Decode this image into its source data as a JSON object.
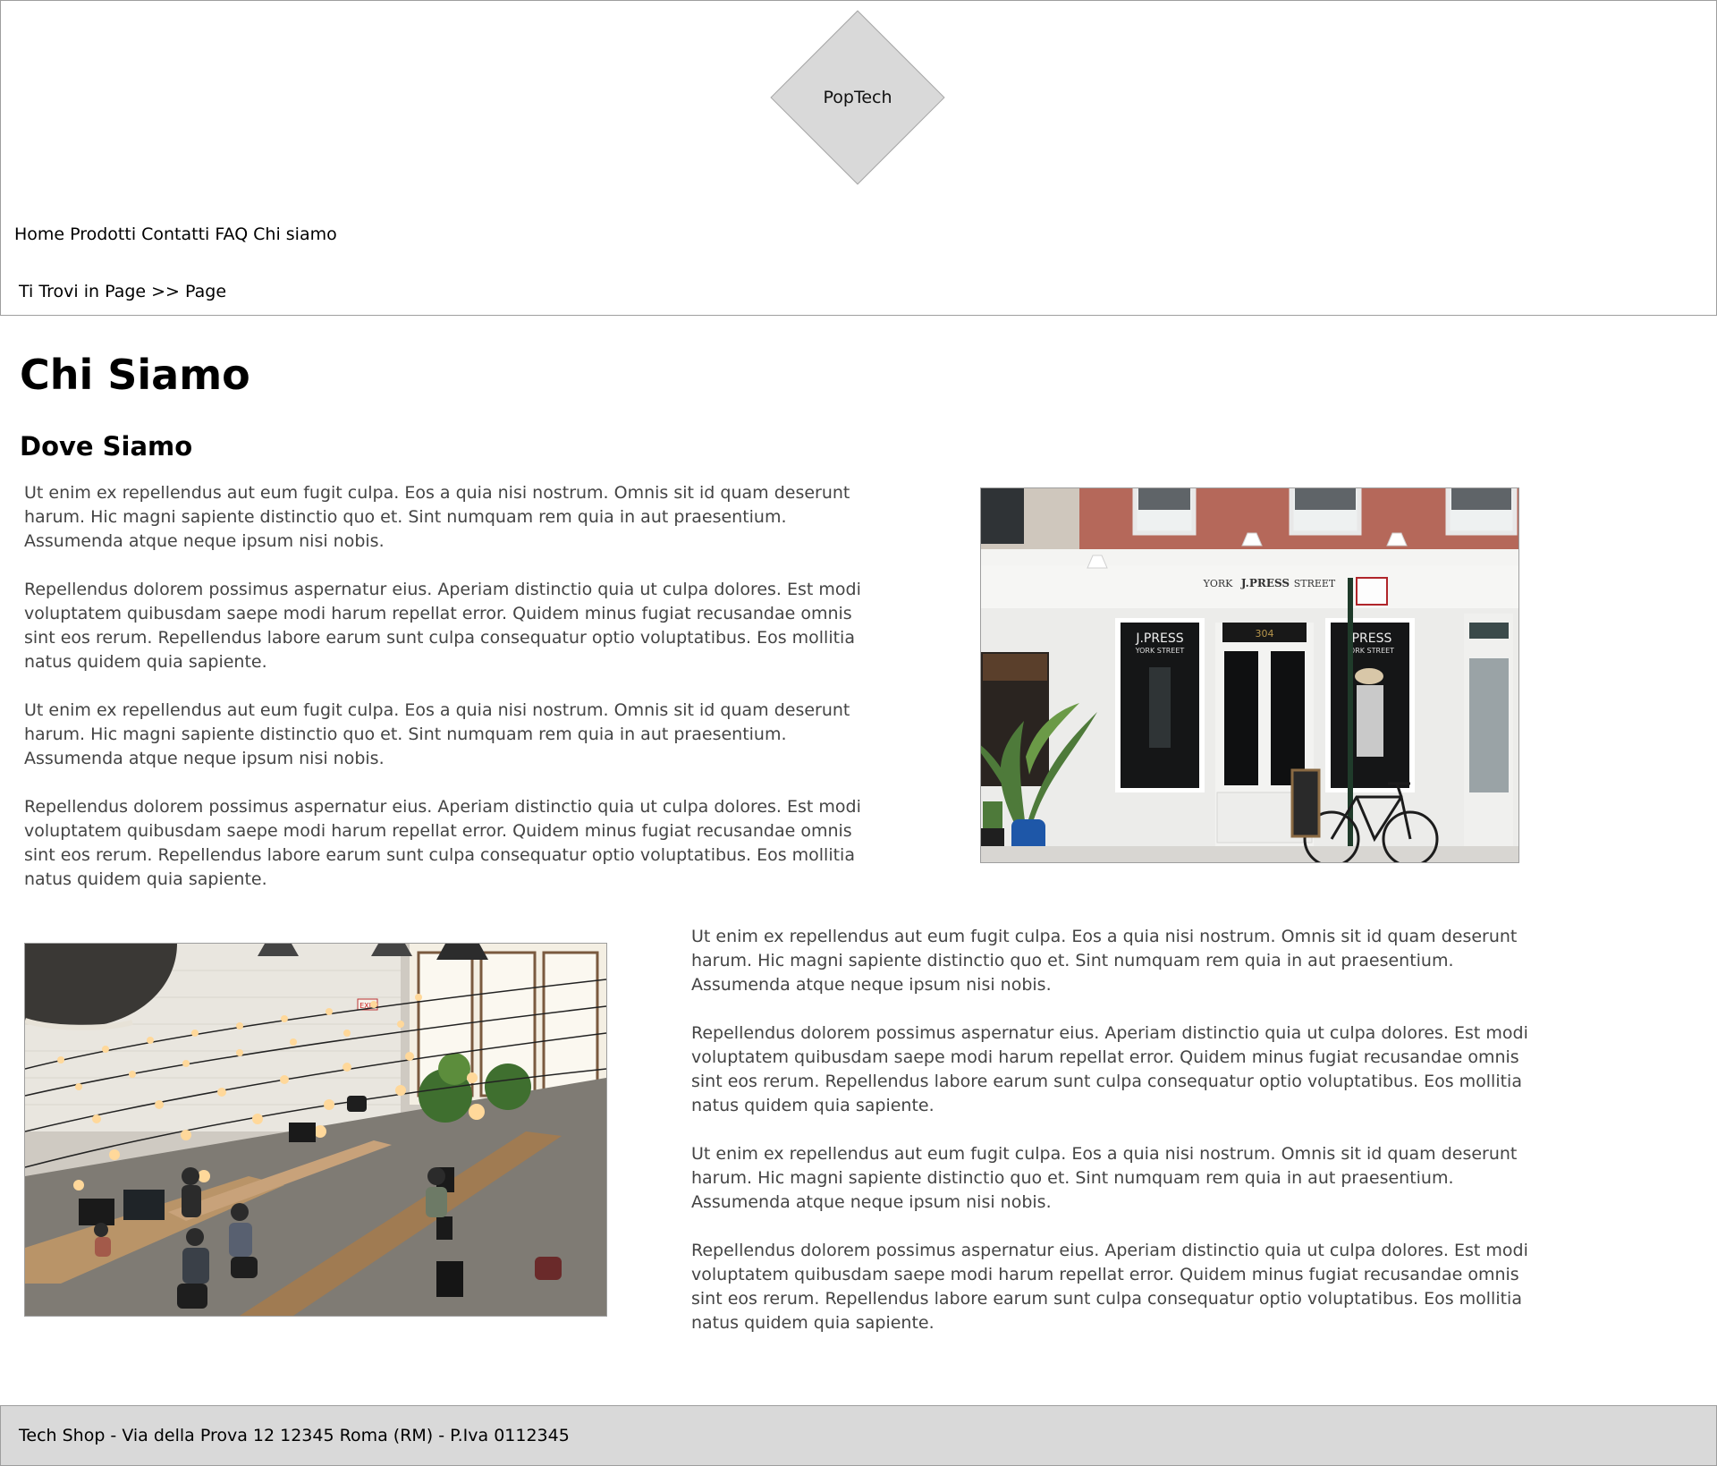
{
  "header": {
    "logo_text": "PopTech"
  },
  "nav": {
    "items": [
      "Home",
      "Prodotti",
      "Contatti",
      "FAQ",
      "Chi siamo"
    ]
  },
  "breadcrumb": {
    "text": "Ti Trovi in Page >> Page"
  },
  "main": {
    "title": "Chi Siamo",
    "subtitle": "Dove Siamo",
    "block1": {
      "p1": "Ut enim ex repellendus aut eum fugit culpa. Eos a quia nisi nostrum. Omnis sit id quam deserunt harum. Hic magni sapiente distinctio quo et. Sint numquam rem quia in aut praesentium. Assumenda atque neque ipsum nisi nobis.",
      "p2": "Repellendus dolorem possimus aspernatur eius. Aperiam distinctio quia ut culpa dolores. Est modi voluptatem quibusdam saepe modi harum repellat error. Quidem minus fugiat recusandae omnis sint eos rerum. Repellendus labore earum sunt culpa consequatur optio voluptatibus. Eos mollitia natus quidem quia sapiente.",
      "p3": "Ut enim ex repellendus aut eum fugit culpa. Eos a quia nisi nostrum. Omnis sit id quam deserunt harum. Hic magni sapiente distinctio quo et. Sint numquam rem quia in aut praesentium. Assumenda atque neque ipsum nisi nobis.",
      "p4": "Repellendus dolorem possimus aspernatur eius. Aperiam distinctio quia ut culpa dolores. Est modi voluptatem quibusdam saepe modi harum repellat error. Quidem minus fugiat recusandae omnis sint eos rerum. Repellendus labore earum sunt culpa consequatur optio voluptatibus. Eos mollitia natus quidem quia sapiente."
    },
    "block2": {
      "p1": "Ut enim ex repellendus aut eum fugit culpa. Eos a quia nisi nostrum. Omnis sit id quam deserunt harum. Hic magni sapiente distinctio quo et. Sint numquam rem quia in aut praesentium. Assumenda atque neque ipsum nisi nobis.",
      "p2": "Repellendus dolorem possimus aspernatur eius. Aperiam distinctio quia ut culpa dolores. Est modi voluptatem quibusdam saepe modi harum repellat error. Quidem minus fugiat recusandae omnis sint eos rerum. Repellendus labore earum sunt culpa consequatur optio voluptatibus. Eos mollitia natus quidem quia sapiente.",
      "p3": "Ut enim ex repellendus aut eum fugit culpa. Eos a quia nisi nostrum. Omnis sit id quam deserunt harum. Hic magni sapiente distinctio quo et. Sint numquam rem quia in aut praesentium. Assumenda atque neque ipsum nisi nobis.",
      "p4": "Repellendus dolorem possimus aspernatur eius. Aperiam distinctio quia ut culpa dolores. Est modi voluptatem quibusdam saepe modi harum repellat error. Quidem minus fugiat recusandae omnis sint eos rerum. Repellendus labore earum sunt culpa consequatur optio voluptatibus. Eos mollitia natus quidem quia sapiente."
    },
    "store_photo": {
      "sign_left": "YORK",
      "sign_logo": "J.PRESS",
      "sign_right": "STREET",
      "window_left": "J.PRESS",
      "window_left_sub": "YORK STREET",
      "window_right": "PRESS",
      "window_right_sub": "ORK STREET",
      "door_number": "304"
    },
    "office_photo": {
      "exit_sign": "EXIT"
    }
  },
  "footer": {
    "text": "Tech Shop - Via della Prova 12 12345 Roma (RM) - P.Iva 0112345"
  }
}
